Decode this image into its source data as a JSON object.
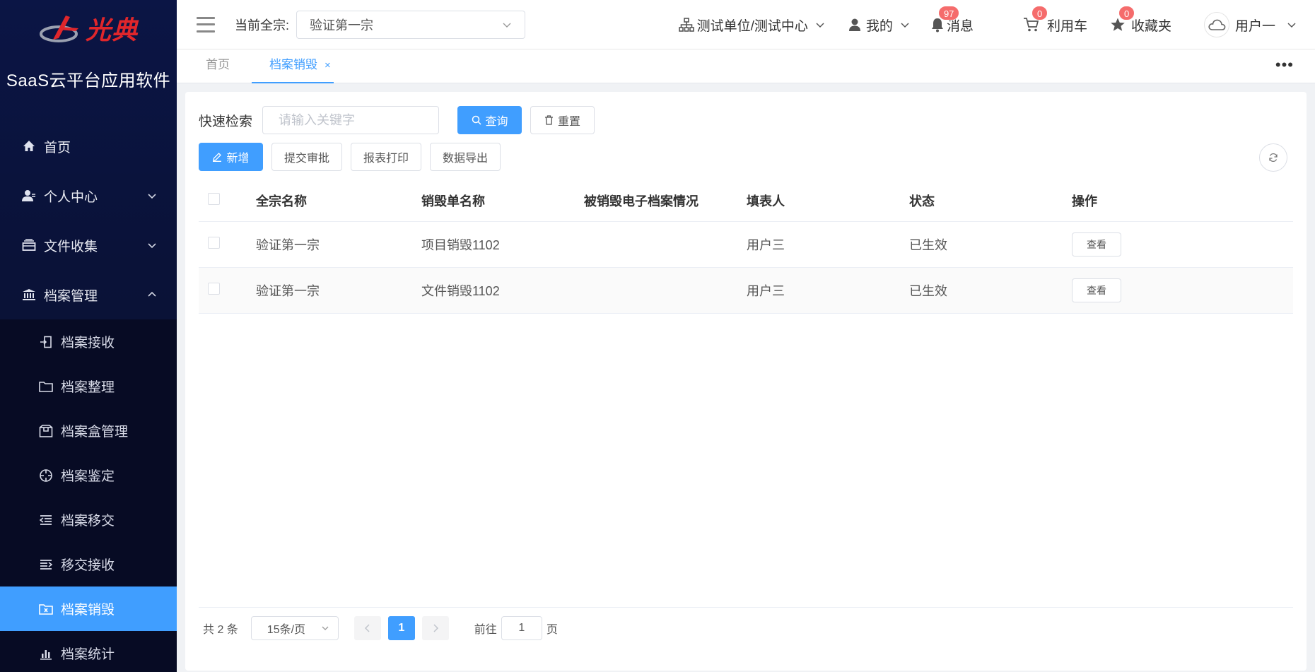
{
  "app": {
    "logo_text": "光典",
    "title": "SaaS云平台应用软件"
  },
  "sidebar": {
    "items": [
      {
        "label": "首页",
        "icon": "home-icon"
      },
      {
        "label": "个人中心",
        "icon": "user-icon",
        "expanded": false
      },
      {
        "label": "文件收集",
        "icon": "tray-icon",
        "expanded": false
      },
      {
        "label": "档案管理",
        "icon": "bank-icon",
        "expanded": true
      }
    ],
    "subitems": [
      {
        "label": "档案接收",
        "icon": "import-icon"
      },
      {
        "label": "档案整理",
        "icon": "folder-icon"
      },
      {
        "label": "档案盒管理",
        "icon": "box-icon"
      },
      {
        "label": "档案鉴定",
        "icon": "crosshair-icon"
      },
      {
        "label": "档案移交",
        "icon": "indent-icon"
      },
      {
        "label": "移交接收",
        "icon": "outdent-icon"
      },
      {
        "label": "档案销毁",
        "icon": "folder-delete-icon",
        "active": true
      },
      {
        "label": "档案统计",
        "icon": "chart-icon"
      }
    ]
  },
  "header": {
    "qz_label": "当前全宗:",
    "qz_value": "验证第一宗",
    "org": "测试单位/测试中心",
    "mine": "我的",
    "messages": "消息",
    "messages_badge": "97",
    "cart": "利用车",
    "cart_badge": "0",
    "favorites": "收藏夹",
    "favorites_badge": "0",
    "user": "用户一"
  },
  "tabs": {
    "items": [
      {
        "label": "首页"
      },
      {
        "label": "档案销毁",
        "active": true
      }
    ],
    "close": "×",
    "more": "•••"
  },
  "search": {
    "label": "快速检索",
    "placeholder": "请输入关键字",
    "query_btn": "查询",
    "reset_btn": "重置"
  },
  "actions": {
    "add": "新增",
    "submit": "提交审批",
    "print": "报表打印",
    "export": "数据导出"
  },
  "table": {
    "headers": [
      "全宗名称",
      "销毁单名称",
      "被销毁电子档案情况",
      "填表人",
      "状态",
      "操作"
    ],
    "rows": [
      {
        "qz": "验证第一宗",
        "name": "项目销毁1102",
        "info": "",
        "filler": "用户三",
        "status": "已生效",
        "op": "查看"
      },
      {
        "qz": "验证第一宗",
        "name": "文件销毁1102",
        "info": "",
        "filler": "用户三",
        "status": "已生效",
        "op": "查看"
      }
    ]
  },
  "pager": {
    "total": "共 2 条",
    "page_size": "15条/页",
    "current": "1",
    "goto_label": "前往",
    "goto_value": "1",
    "page_suffix": "页"
  },
  "colors": {
    "primary": "#409eff",
    "sidebar_bg": "#0b1545",
    "badge": "#f56c6c",
    "logo_red": "#e0262b"
  }
}
